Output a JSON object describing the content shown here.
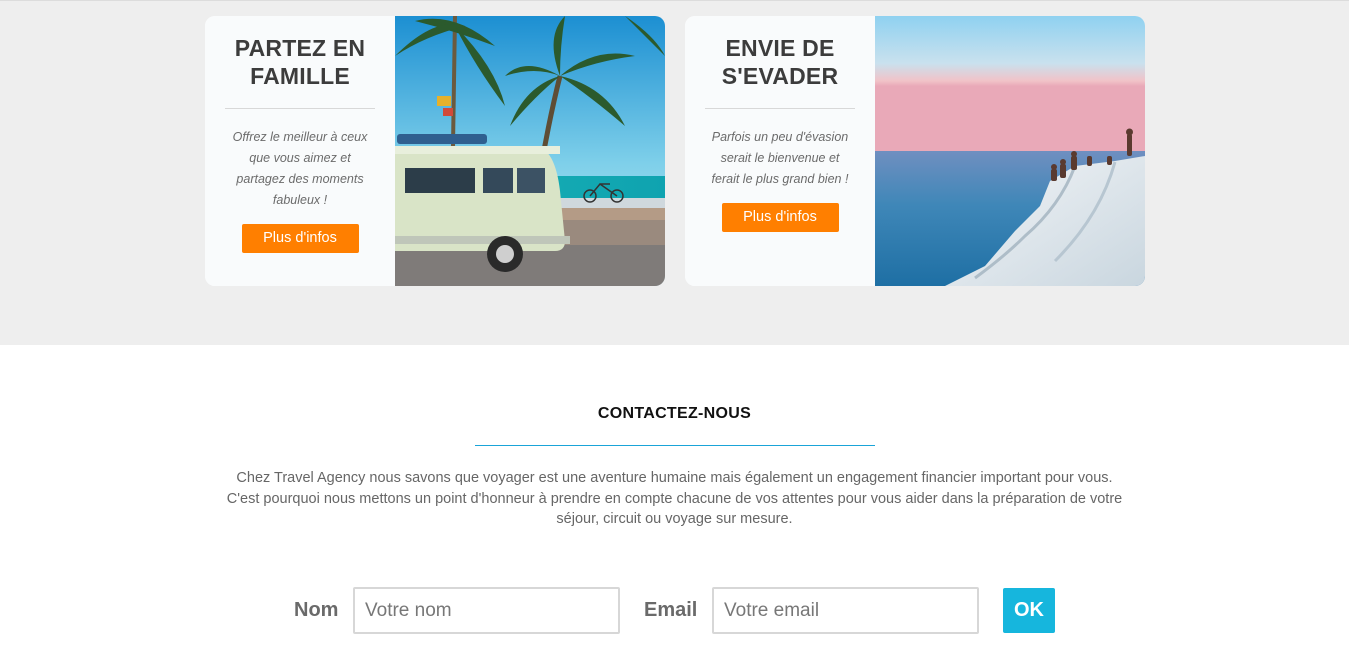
{
  "cards": [
    {
      "title_line1": "PARTEZ EN",
      "title_line2": "FAMILLE",
      "desc_lines": [
        "Offrez le meilleur à ceux",
        "que vous aimez et",
        "partagez des moments",
        "fabuleux !"
      ],
      "button": "Plus d'infos",
      "image_icon": "beach-van-photo"
    },
    {
      "title_line1": "ENVIE DE",
      "title_line2": "S'EVADER",
      "desc_lines": [
        "Parfois un peu d'évasion",
        "serait le bienvenue et",
        "ferait le plus grand bien !"
      ],
      "button": "Plus d'infos",
      "image_icon": "sea-cliff-photo"
    }
  ],
  "contact": {
    "title": "CONTACTEZ-NOUS",
    "text_lines": [
      "Chez Travel Agency nous savons que voyager est une aventure humaine mais également un engagement financier important pour vous.",
      "C'est pourquoi nous mettons un point d'honneur à prendre en compte chacune de vos attentes pour vous aider dans la préparation de votre",
      "séjour, circuit ou voyage sur mesure."
    ],
    "form": {
      "name_label": "Nom",
      "name_placeholder": "Votre nom",
      "email_label": "Email",
      "email_placeholder": "Votre email",
      "submit": "OK"
    }
  },
  "colors": {
    "accent_orange": "#ff7f00",
    "accent_blue": "#16b6dd",
    "band_gray": "#eeeeee"
  }
}
